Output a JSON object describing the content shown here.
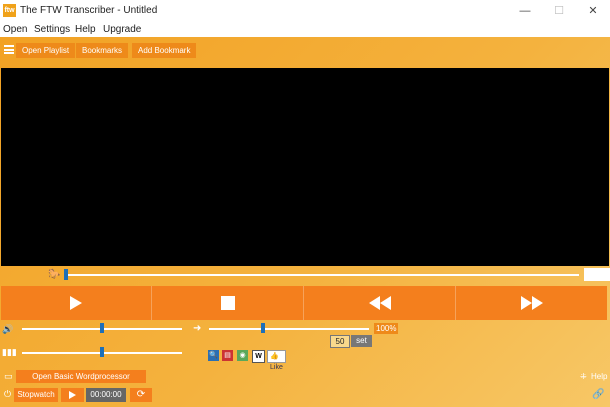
{
  "window": {
    "logo_text": "ftw",
    "title": "The FTW Transcriber - Untitled",
    "minimize": "—",
    "maximize": "☐",
    "close": "✕"
  },
  "menu": [
    "Open",
    "Settings",
    "Help",
    "Upgrade"
  ],
  "toolbar": {
    "open_playlist": "Open Playlist",
    "bookmarks": "Bookmarks",
    "add_bookmark": "Add Bookmark"
  },
  "seek": {
    "position": 0.003
  },
  "controls": {
    "play": "play-icon",
    "stop": "stop-icon",
    "rewind": "rewind-icon",
    "fast_forward": "fast-forward-icon"
  },
  "volume": {
    "level": 0.5
  },
  "speed": {
    "level": 0.34,
    "percent_label": "100%",
    "step_value": "50",
    "set_label": "set"
  },
  "balance": {
    "level": 0.5
  },
  "social": {
    "like_label": "Like",
    "wiki_letter": "W"
  },
  "bottom": {
    "open_wordprocessor": "Open Basic Wordprocessor",
    "help": "Help",
    "stopwatch": "Stopwatch",
    "stopwatch_time": "00:00:00"
  },
  "colors": {
    "accent_orange": "#f47f1d",
    "panel_orange": "#f2a224",
    "slider_thumb": "#1d6fb8"
  }
}
